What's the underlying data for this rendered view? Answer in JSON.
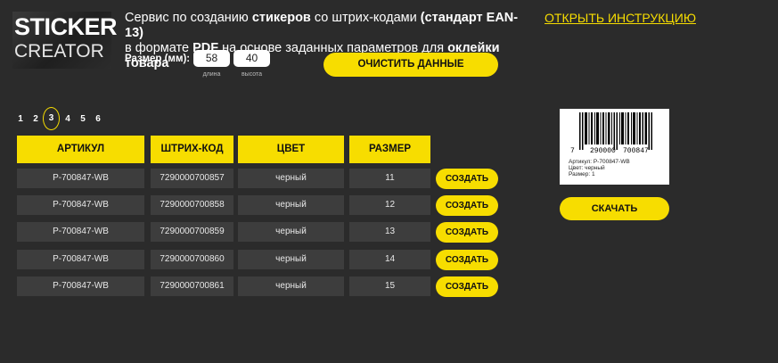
{
  "logo": {
    "line1": "STICKER",
    "line2": "CREATOR"
  },
  "description": {
    "p1": "Сервис по созданию ",
    "b1": "стикеров",
    "p2": " со штрих-кодами ",
    "b2": "(стандарт EAN-13)",
    "p3": "в формате ",
    "b3": "PDF",
    "p4": " на основе заданных параметров для ",
    "b4": "оклейки товара"
  },
  "instruction_link": "ОТКРЫТЬ ИНСТРУКЦИЮ",
  "size": {
    "label": "Размер (мм):",
    "length": "58",
    "height": "40",
    "length_caption": "длина",
    "height_caption": "высота"
  },
  "clear_button": "ОЧИСТИТЬ ДАННЫЕ",
  "pagination": {
    "pages": [
      "1",
      "2",
      "3",
      "4",
      "5",
      "6"
    ],
    "active": "3"
  },
  "table": {
    "headers": [
      "АРТИКУЛ",
      "ШТРИХ-КОД",
      "ЦВЕТ",
      "РАЗМЕР"
    ],
    "rows": [
      {
        "sku": "P-700847-WB",
        "barcode": "7290000700857",
        "color": "черный",
        "size": "11"
      },
      {
        "sku": "P-700847-WB",
        "barcode": "7290000700858",
        "color": "черный",
        "size": "12"
      },
      {
        "sku": "P-700847-WB",
        "barcode": "7290000700859",
        "color": "черный",
        "size": "13"
      },
      {
        "sku": "P-700847-WB",
        "barcode": "7290000700860",
        "color": "черный",
        "size": "14"
      },
      {
        "sku": "P-700847-WB",
        "barcode": "7290000700861",
        "color": "черный",
        "size": "15"
      }
    ],
    "create_label": "СОЗДАТЬ"
  },
  "preview": {
    "digit_first": "7",
    "digits_left": "290000",
    "digits_right": "700847",
    "article": "Артикул: P-700847-WB",
    "color": "Цвет: черный",
    "size": "Размер: 1"
  },
  "download_button": "СКАЧАТЬ",
  "colors": {
    "background": "#2b2b2b",
    "accent": "#f7dd00",
    "cell": "#3d3d3d"
  }
}
